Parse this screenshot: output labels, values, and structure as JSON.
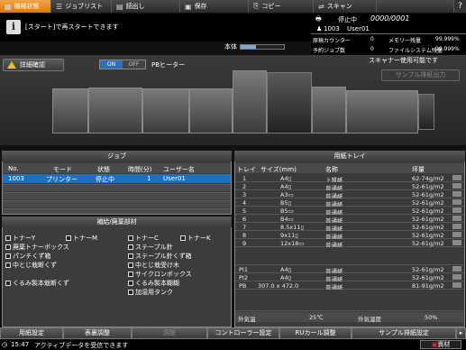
{
  "tabs": [
    {
      "label": "機械状態",
      "icon": "machine-icon",
      "active": true
    },
    {
      "label": "ジョブリスト",
      "icon": "list-icon",
      "active": false
    },
    {
      "label": "読出し",
      "icon": "folder-icon",
      "active": false
    },
    {
      "label": "保存",
      "icon": "save-icon",
      "active": false
    },
    {
      "label": "コピー",
      "icon": "copy-icon",
      "active": false
    },
    {
      "label": "スキャン",
      "icon": "scan-icon",
      "active": false
    }
  ],
  "help_label": "?",
  "message": "[スタート]で再スタートできます",
  "status": {
    "state": "停止中",
    "count": "0000/0001",
    "user_id": "1003",
    "user_name": "User01"
  },
  "counters": {
    "print_counter_label": "原稿カウンター",
    "print_counter_value": "0",
    "memory_label": "メモリー残量",
    "memory_value": "99.999%",
    "reserved_label": "予約ジョブ数",
    "reserved_value": "0",
    "file_label": "ファイルシステム残量",
    "file_value": "99.999%"
  },
  "main_body_label": "本体",
  "toner_progress": 0.35,
  "warn_button": "詳細確認",
  "pb_on": "ON",
  "pb_off": "OFF",
  "pb_label": "PBヒーター",
  "scanner_status": "スキャナー使用可能です",
  "sample_button": "サンプル排紙出力",
  "job": {
    "title": "ジョブ",
    "columns": [
      "No.",
      "モード",
      "状態",
      "時間(分)",
      "ユーザー名"
    ],
    "rows": [
      {
        "no": "1003",
        "mode": "プリンター",
        "state": "停止中",
        "time": "1",
        "user": "User01"
      }
    ]
  },
  "supply": {
    "title": "補給/廃棄部材",
    "items": [
      [
        "トナーY",
        "トナーM",
        "トナーC",
        "トナーK"
      ],
      [
        "廃棄トナーボックス",
        "ステープル針"
      ],
      [
        "パンチくず箱",
        "ステープル針くず箱"
      ],
      [
        "中とじ栽断くず",
        "中とじ栽受け木"
      ],
      [
        "サイクロンボックス"
      ],
      [
        "くるみ製本栽断くず",
        "くるみ製本糊糊"
      ],
      [
        "加湿用タンク"
      ]
    ]
  },
  "tray": {
    "title": "用紙トレイ",
    "columns": [
      "トレイ",
      "サイズ(mm)",
      "名称",
      "坪量"
    ],
    "rows": [
      {
        "tray": "1",
        "size": "A4▯",
        "name": "上質紙",
        "weight": "62-74g/m2"
      },
      {
        "tray": "2",
        "size": "A4▯",
        "name": "普通紙",
        "weight": "52-61g/m2"
      },
      {
        "tray": "3",
        "size": "A3▭",
        "name": "普通紙",
        "weight": "52-61g/m2"
      },
      {
        "tray": "4",
        "size": "B5▯",
        "name": "普通紙",
        "weight": "52-61g/m2"
      },
      {
        "tray": "5",
        "size": "B5▭",
        "name": "普通紙",
        "weight": "52-61g/m2"
      },
      {
        "tray": "6",
        "size": "B4▭",
        "name": "普通紙",
        "weight": "52-61g/m2"
      },
      {
        "tray": "7",
        "size": "8.5x11▯",
        "name": "普通紙",
        "weight": "52-61g/m2"
      },
      {
        "tray": "8",
        "size": "9x11▯",
        "name": "普通紙",
        "weight": "52-61g/m2"
      },
      {
        "tray": "9",
        "size": "12x18▭",
        "name": "普通紙",
        "weight": "52-61g/m2"
      },
      {
        "tray": "PI1",
        "size": "A4▯",
        "name": "普通紙",
        "weight": "52-61g/m2"
      },
      {
        "tray": "PI2",
        "size": "A4▯",
        "name": "普通紙",
        "weight": "52-61g/m2"
      },
      {
        "tray": "PB",
        "size": "307.0 x 472.0",
        "name": "普通紙",
        "weight": "81-91g/m2"
      }
    ],
    "outside_temp_label": "外気温",
    "outside_temp_value": "25℃",
    "outside_humid_label": "外気湿度",
    "outside_humid_value": "50%"
  },
  "bottom_buttons": [
    {
      "label": "用紙設定",
      "disabled": false
    },
    {
      "label": "表裏調整",
      "disabled": false
    },
    {
      "label": "調整",
      "disabled": true
    },
    {
      "label": "コントローラー設定",
      "disabled": false
    },
    {
      "label": "RUカール調整",
      "disabled": false
    },
    {
      "label": "サンプル排紙設定",
      "disabled": false
    }
  ],
  "status_line": {
    "time": "15:47",
    "message": "アクティブデータを受信できます",
    "supply_label": "資材"
  },
  "colors": {
    "accent": "#e68a1e",
    "selected_row": "#1e6fbf",
    "on_toggle": "#2a6fb8"
  }
}
